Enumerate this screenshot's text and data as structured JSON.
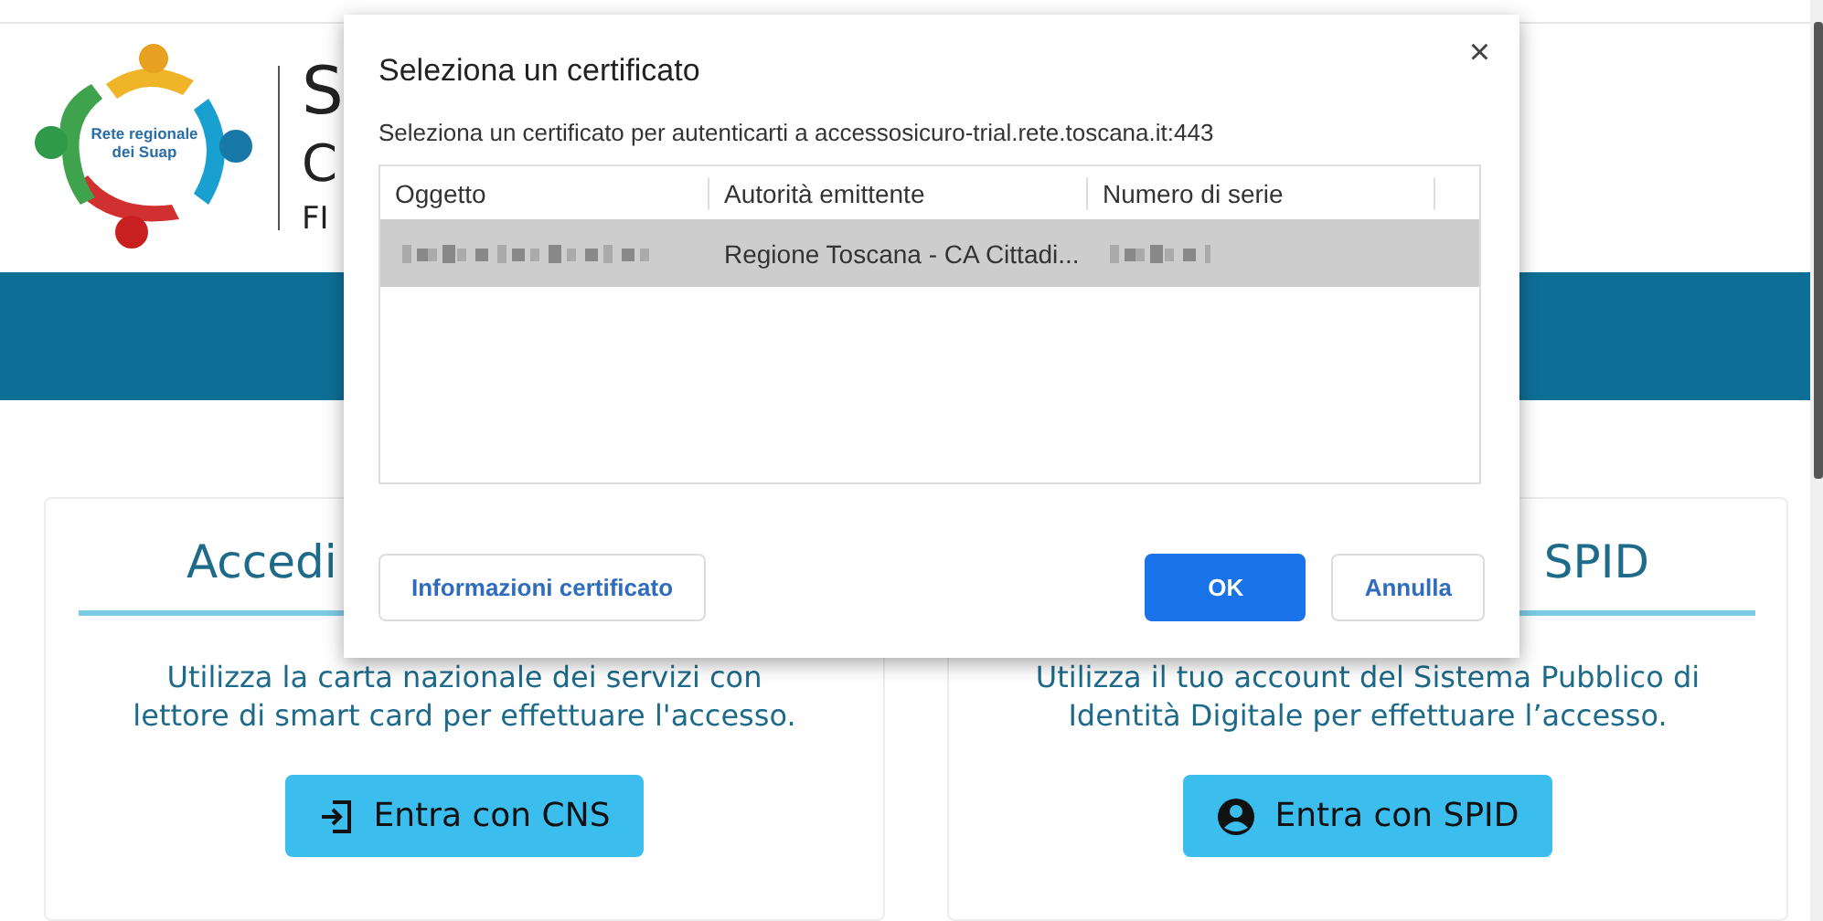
{
  "header": {
    "logo_text": "Rete regionale dei Suap",
    "title": "S",
    "subtitle": "C",
    "caption": "FI"
  },
  "cards": [
    {
      "kind": "cns",
      "title": "Accedi",
      "description": [
        "Utilizza la carta nazionale dei servizi con",
        "lettore di smart card per effettuare l'accesso."
      ],
      "button": "Entra con CNS"
    },
    {
      "kind": "spid",
      "title": "SPID",
      "description": [
        "Utilizza il tuo account del Sistema Pubblico di",
        "Identità Digitale per effettuare l’accesso."
      ],
      "button": "Entra con SPID"
    }
  ],
  "dialog": {
    "title": "Seleziona un certificato",
    "close": "×",
    "message": "Seleziona un certificato per autenticarti a accessosicuro-trial.rete.toscana.it:443",
    "columns": [
      "Oggetto",
      "Autorità emittente",
      "Numero di serie"
    ],
    "rows": [
      {
        "selected": true,
        "issuer": "Regione Toscana - CA Cittadi..."
      }
    ],
    "buttons": [
      {
        "kind": "secondary",
        "label": "Informazioni certificato"
      },
      {
        "kind": "primary",
        "label": "OK"
      },
      {
        "kind": "secondary",
        "label": "Annulla"
      }
    ]
  }
}
